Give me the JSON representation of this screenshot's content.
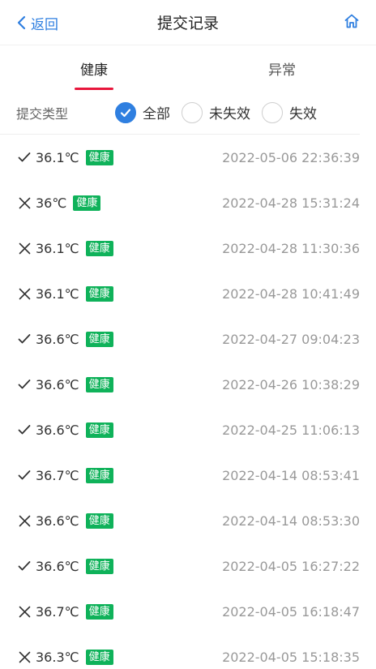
{
  "nav": {
    "back_label": "返回",
    "title": "提交记录"
  },
  "tabs": [
    {
      "label": "健康",
      "active": true
    },
    {
      "label": "异常",
      "active": false
    }
  ],
  "filter": {
    "label": "提交类型",
    "options": [
      {
        "label": "全部",
        "checked": true
      },
      {
        "label": "未失效",
        "checked": false
      },
      {
        "label": "失效",
        "checked": false
      }
    ]
  },
  "records": [
    {
      "status": "check",
      "temp": "36.1℃",
      "badge": "健康",
      "time": "2022-05-06 22:36:39"
    },
    {
      "status": "cross",
      "temp": "36℃",
      "badge": "健康",
      "time": "2022-04-28 15:31:24"
    },
    {
      "status": "cross",
      "temp": "36.1℃",
      "badge": "健康",
      "time": "2022-04-28 11:30:36"
    },
    {
      "status": "cross",
      "temp": "36.1℃",
      "badge": "健康",
      "time": "2022-04-28 10:41:49"
    },
    {
      "status": "check",
      "temp": "36.6℃",
      "badge": "健康",
      "time": "2022-04-27 09:04:23"
    },
    {
      "status": "check",
      "temp": "36.6℃",
      "badge": "健康",
      "time": "2022-04-26 10:38:29"
    },
    {
      "status": "check",
      "temp": "36.6℃",
      "badge": "健康",
      "time": "2022-04-25 11:06:13"
    },
    {
      "status": "check",
      "temp": "36.7℃",
      "badge": "健康",
      "time": "2022-04-14 08:53:41"
    },
    {
      "status": "cross",
      "temp": "36.6℃",
      "badge": "健康",
      "time": "2022-04-14 08:53:30"
    },
    {
      "status": "check",
      "temp": "36.6℃",
      "badge": "健康",
      "time": "2022-04-05 16:27:22"
    },
    {
      "status": "cross",
      "temp": "36.7℃",
      "badge": "健康",
      "time": "2022-04-05 16:18:47"
    },
    {
      "status": "cross",
      "temp": "36.3℃",
      "badge": "健康",
      "time": "2022-04-05 15:18:35"
    }
  ],
  "colors": {
    "accent": "#2f7fe0",
    "tab_indicator": "#e8163c",
    "badge": "#0fb25a"
  }
}
